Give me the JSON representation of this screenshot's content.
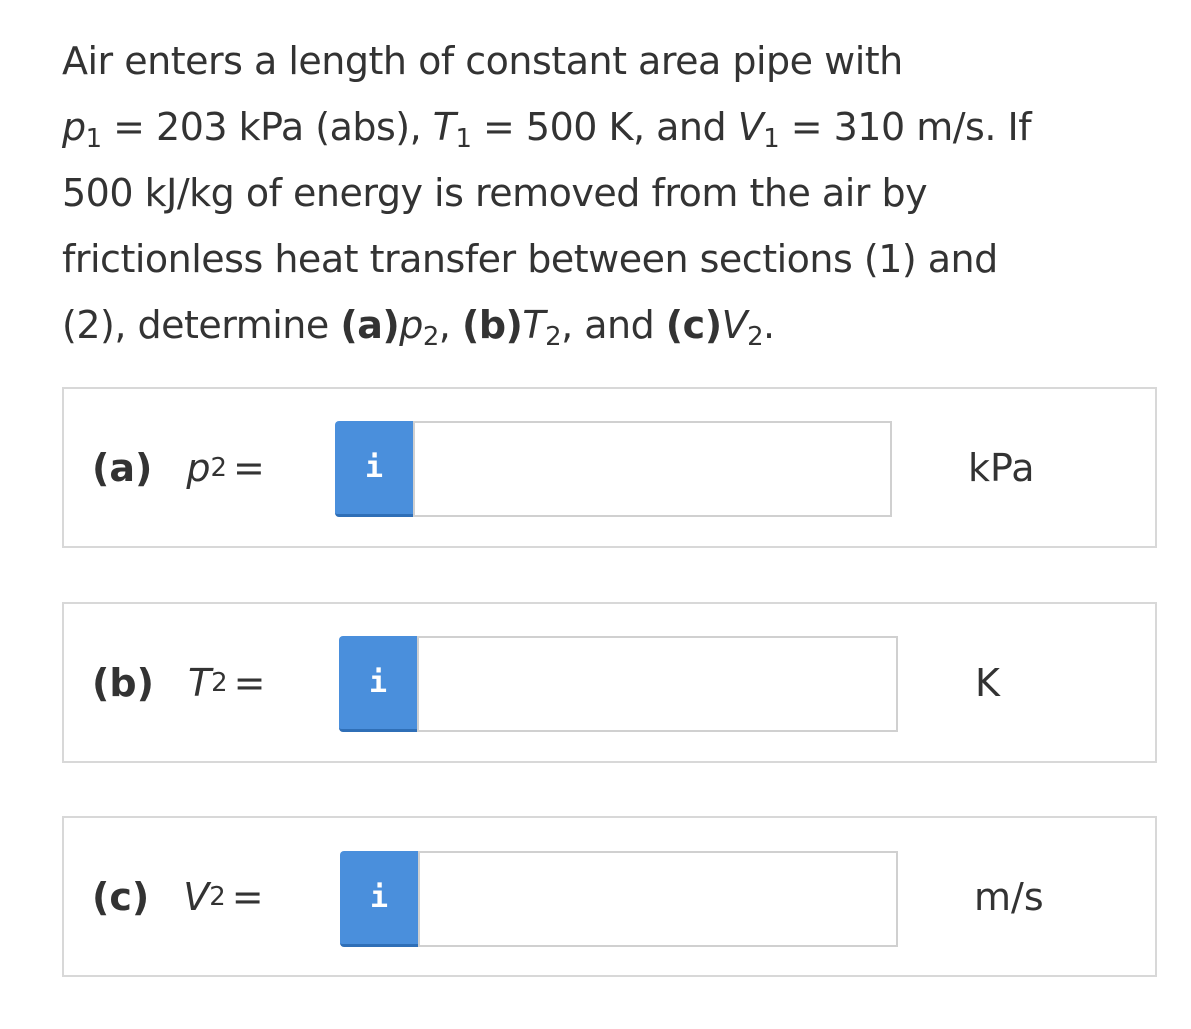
{
  "problem": {
    "line1": "Air enters a length of constant area pipe with",
    "line2": {
      "p_var": "p",
      "p_sub": "1",
      "p_rest": " = 203 kPa (abs), ",
      "t_var": "T",
      "t_sub": "1",
      "t_rest": " = 500 K, and ",
      "v_var": "V",
      "v_sub": "1",
      "v_rest": " = 310 m/s. If"
    },
    "line3": "500 kJ/kg of energy is removed from the air by",
    "line4": "frictionless heat transfer between sections (1) and",
    "line5": {
      "lead": "(2), determine ",
      "a_part": "(a)",
      "a_var": "p",
      "a_sub": "2",
      "sep1": ", ",
      "b_part": "(b)",
      "b_var": "T",
      "b_sub": "2",
      "sep2": ", and ",
      "c_part": "(c)",
      "c_var": "V",
      "c_sub": "2",
      "end": "."
    }
  },
  "answers": [
    {
      "part": "(a)",
      "var": "p",
      "sub": "2",
      "eq": "=",
      "info_icon": "i",
      "value": "",
      "unit": "kPa"
    },
    {
      "part": "(b)",
      "var": "T",
      "sub": "2",
      "eq": "=",
      "info_icon": "i",
      "value": "",
      "unit": "K"
    },
    {
      "part": "(c)",
      "var": "V",
      "sub": "2",
      "eq": "=",
      "info_icon": "i",
      "value": "",
      "unit": "m/s"
    }
  ],
  "colors": {
    "info_button": "#4a8fdc",
    "text": "#333333",
    "box_border": "#d8d8d8"
  }
}
